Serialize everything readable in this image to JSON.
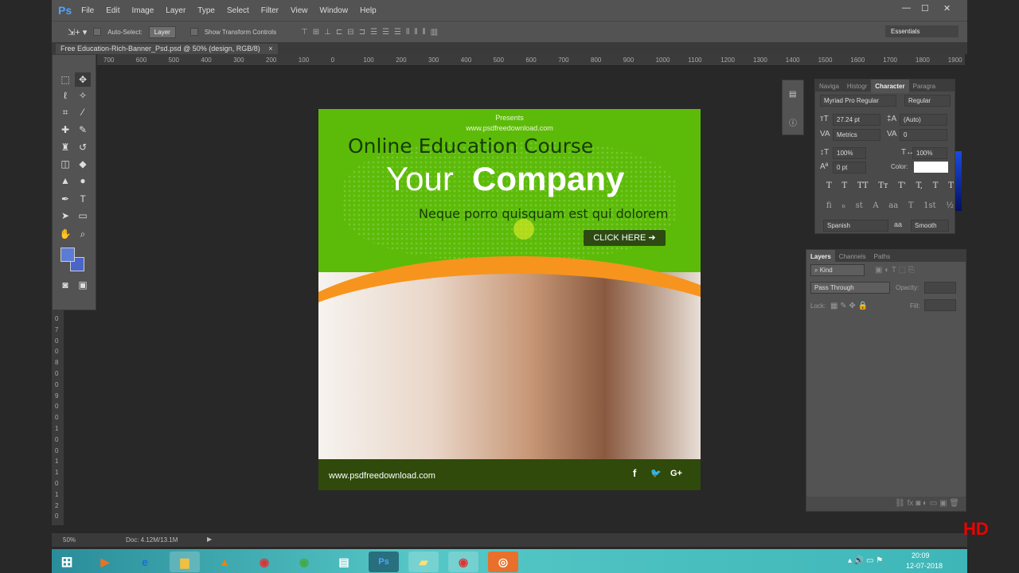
{
  "app": {
    "logo": "Ps",
    "menu": [
      "File",
      "Edit",
      "Image",
      "Layer",
      "Type",
      "Select",
      "Filter",
      "View",
      "Window",
      "Help"
    ],
    "window_controls": [
      "—",
      "☐",
      "✕"
    ]
  },
  "options": {
    "auto_select_label": "Auto-Select:",
    "auto_select_value": "Layer",
    "show_transform_label": "Show Transform Controls",
    "workspace": "Essentials"
  },
  "document": {
    "tab_title": "Free Education-Rich-Banner_Psd.psd @ 50% (design, RGB/8)",
    "close": "×"
  },
  "ruler": {
    "h_labels": [
      "700",
      "600",
      "500",
      "400",
      "300",
      "200",
      "100",
      "0",
      "100",
      "200",
      "300",
      "400",
      "500",
      "600",
      "700",
      "800",
      "900",
      "1000",
      "1100",
      "1200",
      "1300",
      "1400",
      "1500",
      "1600",
      "1700",
      "1800",
      "1900"
    ],
    "v_labels": [
      "0",
      "7",
      "0",
      "0",
      "8",
      "0",
      "0",
      "9",
      "0",
      "0",
      "1",
      "0",
      "0",
      "1",
      "1",
      "0",
      "1",
      "2",
      "0"
    ]
  },
  "banner": {
    "presents": "Presents",
    "site_top": "www.psdfreedownload.com",
    "headline": "Online Education Course",
    "your": "Your",
    "company": "Company",
    "tagline": "Neque porro quisquam est qui dolorem",
    "cta": "CLICK HERE ➔",
    "site_bottom": "www.psdfreedownload.com",
    "social": [
      "f",
      "🐦",
      "G+"
    ]
  },
  "character_panel": {
    "tabs": [
      "Naviga",
      "Histogr",
      "Character",
      "Paragra"
    ],
    "font_family": "Myriad Pro Regular",
    "font_style": "Regular",
    "size": "27.24 pt",
    "leading": "(Auto)",
    "kerning": "Metrics",
    "tracking": "0",
    "vscale": "100%",
    "hscale": "100%",
    "baseline": "0 pt",
    "color_label": "Color:",
    "color": "#ffffff",
    "style_buttons": [
      "T",
      "T",
      "TT",
      "Tт",
      "T'",
      "T,",
      "T",
      "T"
    ],
    "opentype_buttons": [
      "fi",
      "ℴ",
      "st",
      "A",
      "aa",
      "T",
      "1st",
      "½"
    ],
    "language": "Spanish",
    "aa_label": "aa",
    "antialias": "Smooth"
  },
  "layers_panel": {
    "tabs": [
      "Layers",
      "Channels",
      "Paths"
    ],
    "filter": "Kind",
    "blend": "Pass Through",
    "opacity_label": "Opacity:",
    "lock_label": "Lock:",
    "fill_label": "Fill:"
  },
  "status": {
    "zoom": "50%",
    "doc": "Doc: 4.12M/13.1M"
  },
  "taskbar": {
    "time": "20:09",
    "date": "12-07-2018",
    "apps": [
      "start",
      "media-player",
      "ie",
      "explorer",
      "vlc",
      "chrome",
      "windows-media",
      "document",
      "photoshop",
      "sticky-notes",
      "chrome",
      "recorder"
    ]
  },
  "colors": {
    "banner_green": "#5cbb08",
    "orange": "#f7941d",
    "footer": "#2f4a0a",
    "ui": "#535353",
    "canvas_bg": "#282828"
  }
}
